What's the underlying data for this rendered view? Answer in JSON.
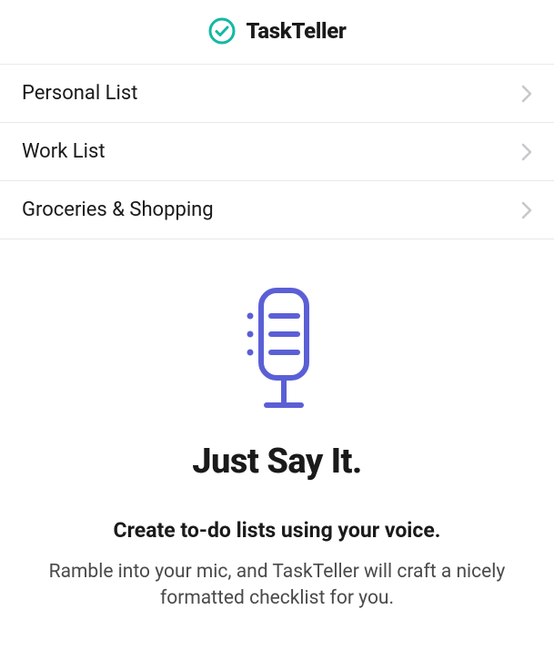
{
  "header": {
    "app_title": "TaskTeller"
  },
  "lists": [
    {
      "label": "Personal List"
    },
    {
      "label": "Work List"
    },
    {
      "label": "Groceries & Shopping"
    }
  ],
  "hero": {
    "title": "Just Say It.",
    "subtitle": "Create to-do lists using your voice.",
    "description": "Ramble into your mic, and TaskTeller will craft a nicely formatted checklist for you."
  },
  "colors": {
    "accent_teal": "#14b8a6",
    "accent_indigo": "#5b5fd6"
  }
}
